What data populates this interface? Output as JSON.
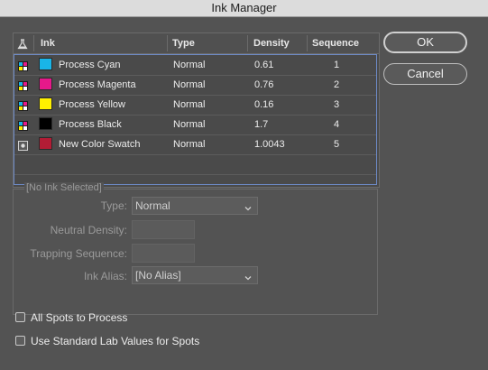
{
  "window": {
    "title": "Ink Manager"
  },
  "table": {
    "headers": {
      "ink": "Ink",
      "type": "Type",
      "density": "Density",
      "sequence": "Sequence"
    },
    "rows": [
      {
        "name": "Process Cyan",
        "type": "Normal",
        "density": "0.61",
        "sequence": "1",
        "color": "#19b5e8",
        "icon": "process-ink"
      },
      {
        "name": "Process Magenta",
        "type": "Normal",
        "density": "0.76",
        "sequence": "2",
        "color": "#e6198a",
        "icon": "process-ink"
      },
      {
        "name": "Process Yellow",
        "type": "Normal",
        "density": "0.16",
        "sequence": "3",
        "color": "#fff000",
        "icon": "process-ink"
      },
      {
        "name": "Process Black",
        "type": "Normal",
        "density": "1.7",
        "sequence": "4",
        "color": "#000000",
        "icon": "process-ink"
      },
      {
        "name": "New Color Swatch",
        "type": "Normal",
        "density": "1.0043",
        "sequence": "5",
        "color": "#b31c35",
        "icon": "spot-ink"
      }
    ]
  },
  "buttons": {
    "ok": "OK",
    "cancel": "Cancel"
  },
  "selected_ink": {
    "group_title": "[No Ink Selected]",
    "type_label": "Type:",
    "type_value": "Normal",
    "neutral_density_label": "Neutral Density:",
    "neutral_density_value": "",
    "trapping_sequence_label": "Trapping Sequence:",
    "trapping_sequence_value": "",
    "ink_alias_label": "Ink Alias:",
    "ink_alias_value": "[No Alias]"
  },
  "options": {
    "all_spots_to_process": {
      "label": "All Spots to Process",
      "checked": false
    },
    "use_standard_lab": {
      "label": "Use Standard Lab Values for Spots",
      "checked": false
    }
  },
  "colors": {
    "selection_border": "#6d8ac7",
    "dialog_bg": "#535353"
  }
}
